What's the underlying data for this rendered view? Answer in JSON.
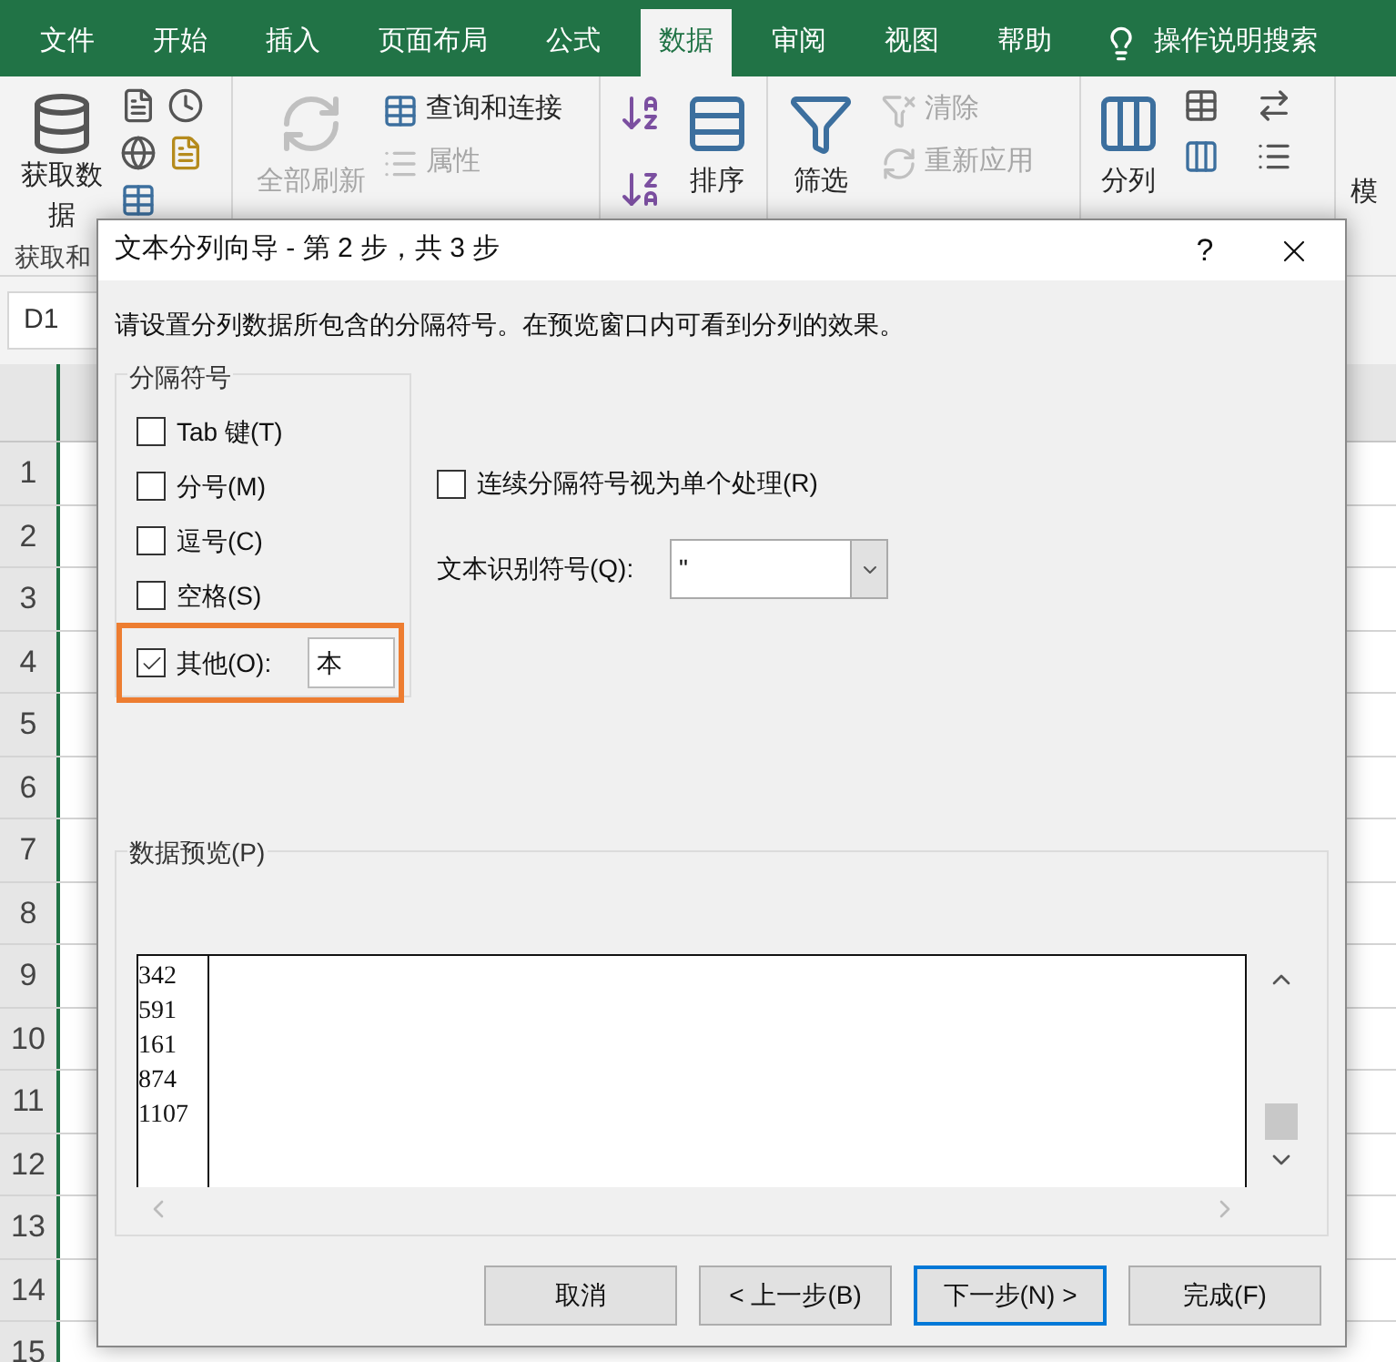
{
  "ribbon_tabs": [
    {
      "label": "文件",
      "selected": false
    },
    {
      "label": "开始",
      "selected": false
    },
    {
      "label": "插入",
      "selected": false
    },
    {
      "label": "页面布局",
      "selected": false
    },
    {
      "label": "公式",
      "selected": false
    },
    {
      "label": "数据",
      "selected": true
    },
    {
      "label": "审阅",
      "selected": false
    },
    {
      "label": "视图",
      "selected": false
    },
    {
      "label": "帮助",
      "selected": false
    }
  ],
  "tell_me": "操作说明搜索",
  "ribbon": {
    "get_data": {
      "label": "获取数据",
      "disabled": false
    },
    "refresh_all": {
      "label": "全部刷新",
      "disabled": true
    },
    "queries": {
      "label": "查询和连接",
      "disabled": false
    },
    "properties": {
      "label": "属性",
      "disabled": true
    },
    "sort": {
      "label": "排序",
      "disabled": false
    },
    "filter": {
      "label": "筛选",
      "disabled": false
    },
    "clear": {
      "label": "清除",
      "disabled": true
    },
    "reapply": {
      "label": "重新应用",
      "disabled": true
    },
    "text_to_columns": {
      "label": "分列",
      "disabled": false
    },
    "what_if": {
      "label": "模",
      "disabled": false
    },
    "group_label": "获取和"
  },
  "name_box": "D1",
  "row_numbers": [
    "1",
    "2",
    "3",
    "4",
    "5",
    "6",
    "7",
    "8",
    "9",
    "10",
    "11",
    "12",
    "13",
    "14",
    "15"
  ],
  "dialog": {
    "title": "文本分列向导 - 第 2 步，共 3 步",
    "help": "?",
    "instruction": "请设置分列数据所包含的分隔符号。在预览窗口内可看到分列的效果。",
    "delimiters": {
      "title": "分隔符号",
      "options": [
        {
          "label": "Tab 键(T)",
          "checked": false
        },
        {
          "label": "分号(M)",
          "checked": false
        },
        {
          "label": "逗号(C)",
          "checked": false
        },
        {
          "label": "空格(S)",
          "checked": false
        }
      ],
      "other": {
        "label": "其他(O):",
        "checked": true,
        "value": "本",
        "highlighted": true
      }
    },
    "consecutive": {
      "label": "连续分隔符号视为单个处理(R)",
      "checked": false
    },
    "text_qualifier": {
      "label": "文本识别符号(Q):",
      "value": "\""
    },
    "preview": {
      "title": "数据预览(P)",
      "rows": [
        "342",
        "591",
        "161",
        "874",
        "1107"
      ]
    },
    "buttons": [
      {
        "label": "取消",
        "default": false
      },
      {
        "label": "< 上一步(B)",
        "default": false
      },
      {
        "label": "下一步(N) >",
        "default": true
      },
      {
        "label": "完成(F)",
        "default": false
      }
    ]
  }
}
